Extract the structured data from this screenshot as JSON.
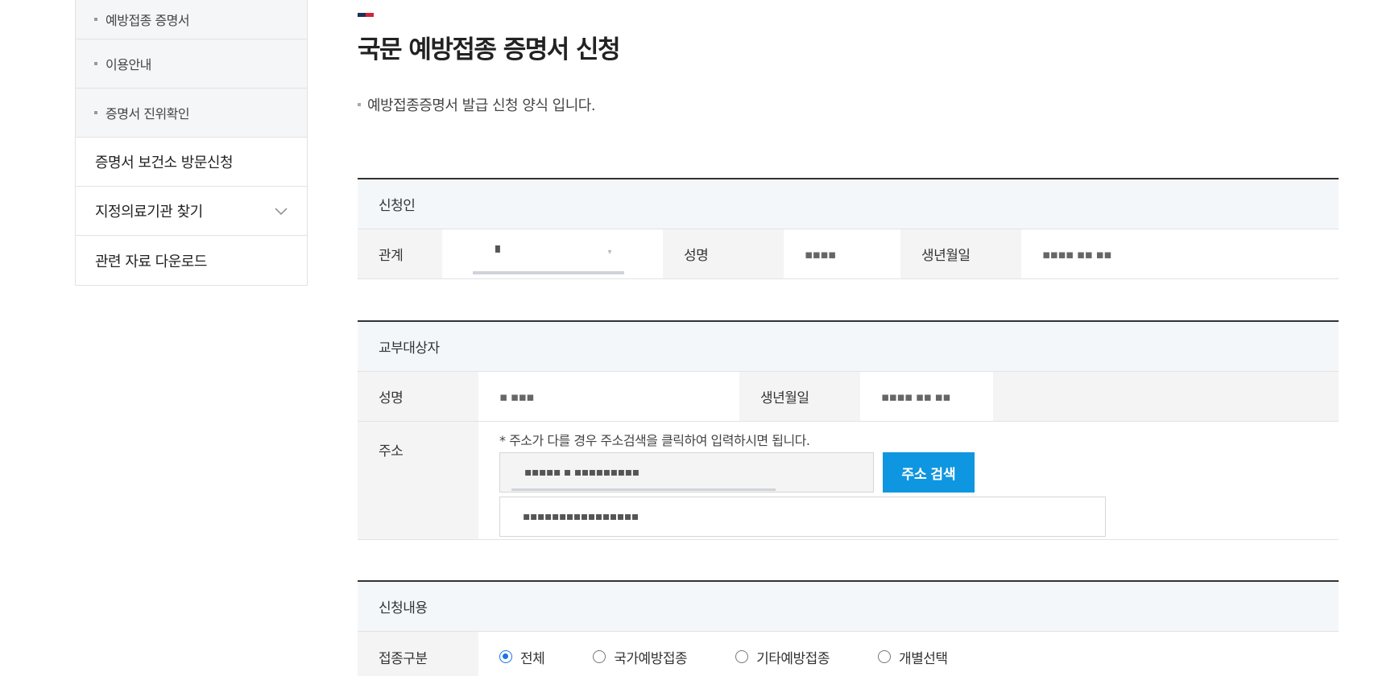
{
  "sidebar": {
    "sub_items": [
      {
        "label": "예방접종 증명서"
      },
      {
        "label": "이용안내"
      },
      {
        "label": "증명서 진위확인"
      }
    ],
    "main_items": [
      {
        "label": "증명서 보건소 방문신청"
      },
      {
        "label": "지정의료기관 찾기",
        "icon": "chevron-down-icon"
      },
      {
        "label": "관련 자료 다운로드"
      }
    ]
  },
  "page": {
    "title": "국문 예방접종 증명서 신청",
    "description": "예방접종증명서 발급 신청 양식 입니다.",
    "accent_colors": [
      "#1f2f5a",
      "#d4233a"
    ]
  },
  "applicant": {
    "heading": "신청인",
    "relation_label": "관계",
    "relation_value": "▘",
    "name_label": "성명",
    "name_value": "▪▪▪▪",
    "birth_label": "생년월일",
    "birth_value": "▪▪▪▪ ▪▪ ▪▪"
  },
  "recipient": {
    "heading": "교부대상자",
    "name_label": "성명",
    "name_value": "▪ ▪▪▪",
    "birth_label": "생년월일",
    "birth_value": "▪▪▪▪ ▪▪ ▪▪",
    "address_label": "주소",
    "address_note": "* 주소가 다를 경우 주소검색을 클릭하여 입력하시면 됩니다.",
    "address_line1": "▪▪▪▪▪ ▪ ▪▪▪▪▪▪▪▪▪",
    "search_button": "주소 검색",
    "address_line2": "▪▪▪▪▪▪▪▪▪▪▪▪▪▪▪▪"
  },
  "request": {
    "heading": "신청내용",
    "type_label": "접종구분",
    "options": [
      {
        "label": "전체",
        "selected": true
      },
      {
        "label": "국가예방접종",
        "selected": false
      },
      {
        "label": "기타예방접종",
        "selected": false
      },
      {
        "label": "개별선택",
        "selected": false
      }
    ]
  }
}
